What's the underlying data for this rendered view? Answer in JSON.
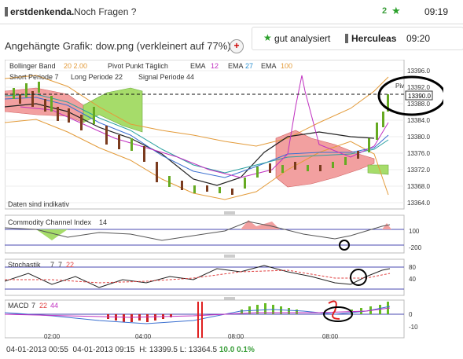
{
  "header": {
    "username": "erstdenkenda.",
    "subject": "Noch Fragen ?",
    "star_count": "2",
    "time": "09:19"
  },
  "post": {
    "attachment_text": "Angehängte Grafik: dow.png (verkleinert auf 77%)"
  },
  "reply": {
    "rating_label": "gut analysiert",
    "username": "Herculeas",
    "time": "09:20"
  },
  "indicators": {
    "bollinger": "Bollinger Band",
    "bollinger_params": "20  2.00",
    "pivot": "Pivot Punkt  Täglich",
    "ema1": "EMA",
    "ema1_val": "12",
    "ema2": "EMA",
    "ema2_val": "27",
    "ema3": "EMA",
    "ema3_val": "100",
    "short": "Short Periode  7",
    "long": "Long Periode  22",
    "signal": "Signal Periode  44",
    "pivot_tag": "Piv",
    "status_text": "Daten sind indikativ"
  },
  "price_axis": {
    "ticks": [
      "13396.0",
      "13392.0",
      "13388.0",
      "13384.0",
      "13380.0",
      "13376.0",
      "13372.0",
      "13368.0",
      "13364.0"
    ],
    "current": "13390.0"
  },
  "cci": {
    "label": "Commodity Channel Index",
    "period": "14",
    "ticks": [
      "100",
      "-200"
    ]
  },
  "stoch": {
    "label": "Stochastik",
    "p1": "7",
    "p2": "7",
    "p3": "22",
    "ticks": [
      "80",
      "40"
    ]
  },
  "macd": {
    "label": "MACD",
    "p1": "7",
    "p2": "22",
    "p3": "44",
    "ticks": [
      "0",
      "-10"
    ]
  },
  "time_axis": [
    "02:00",
    "04:00",
    "08:00",
    "08:00"
  ],
  "footer": {
    "date_from": "04-01-2013 00:55",
    "date_to": "04-01-2013 09:15",
    "hl": "H: 13399.5  L: 13364.5",
    "change": "10.0",
    "pct": "0.1%"
  },
  "colors": {
    "cloud_red": "#f2a0a0",
    "cloud_green": "#a6dc6a",
    "candle_up": "#66aa22",
    "candle_down": "#7a3b1e"
  }
}
